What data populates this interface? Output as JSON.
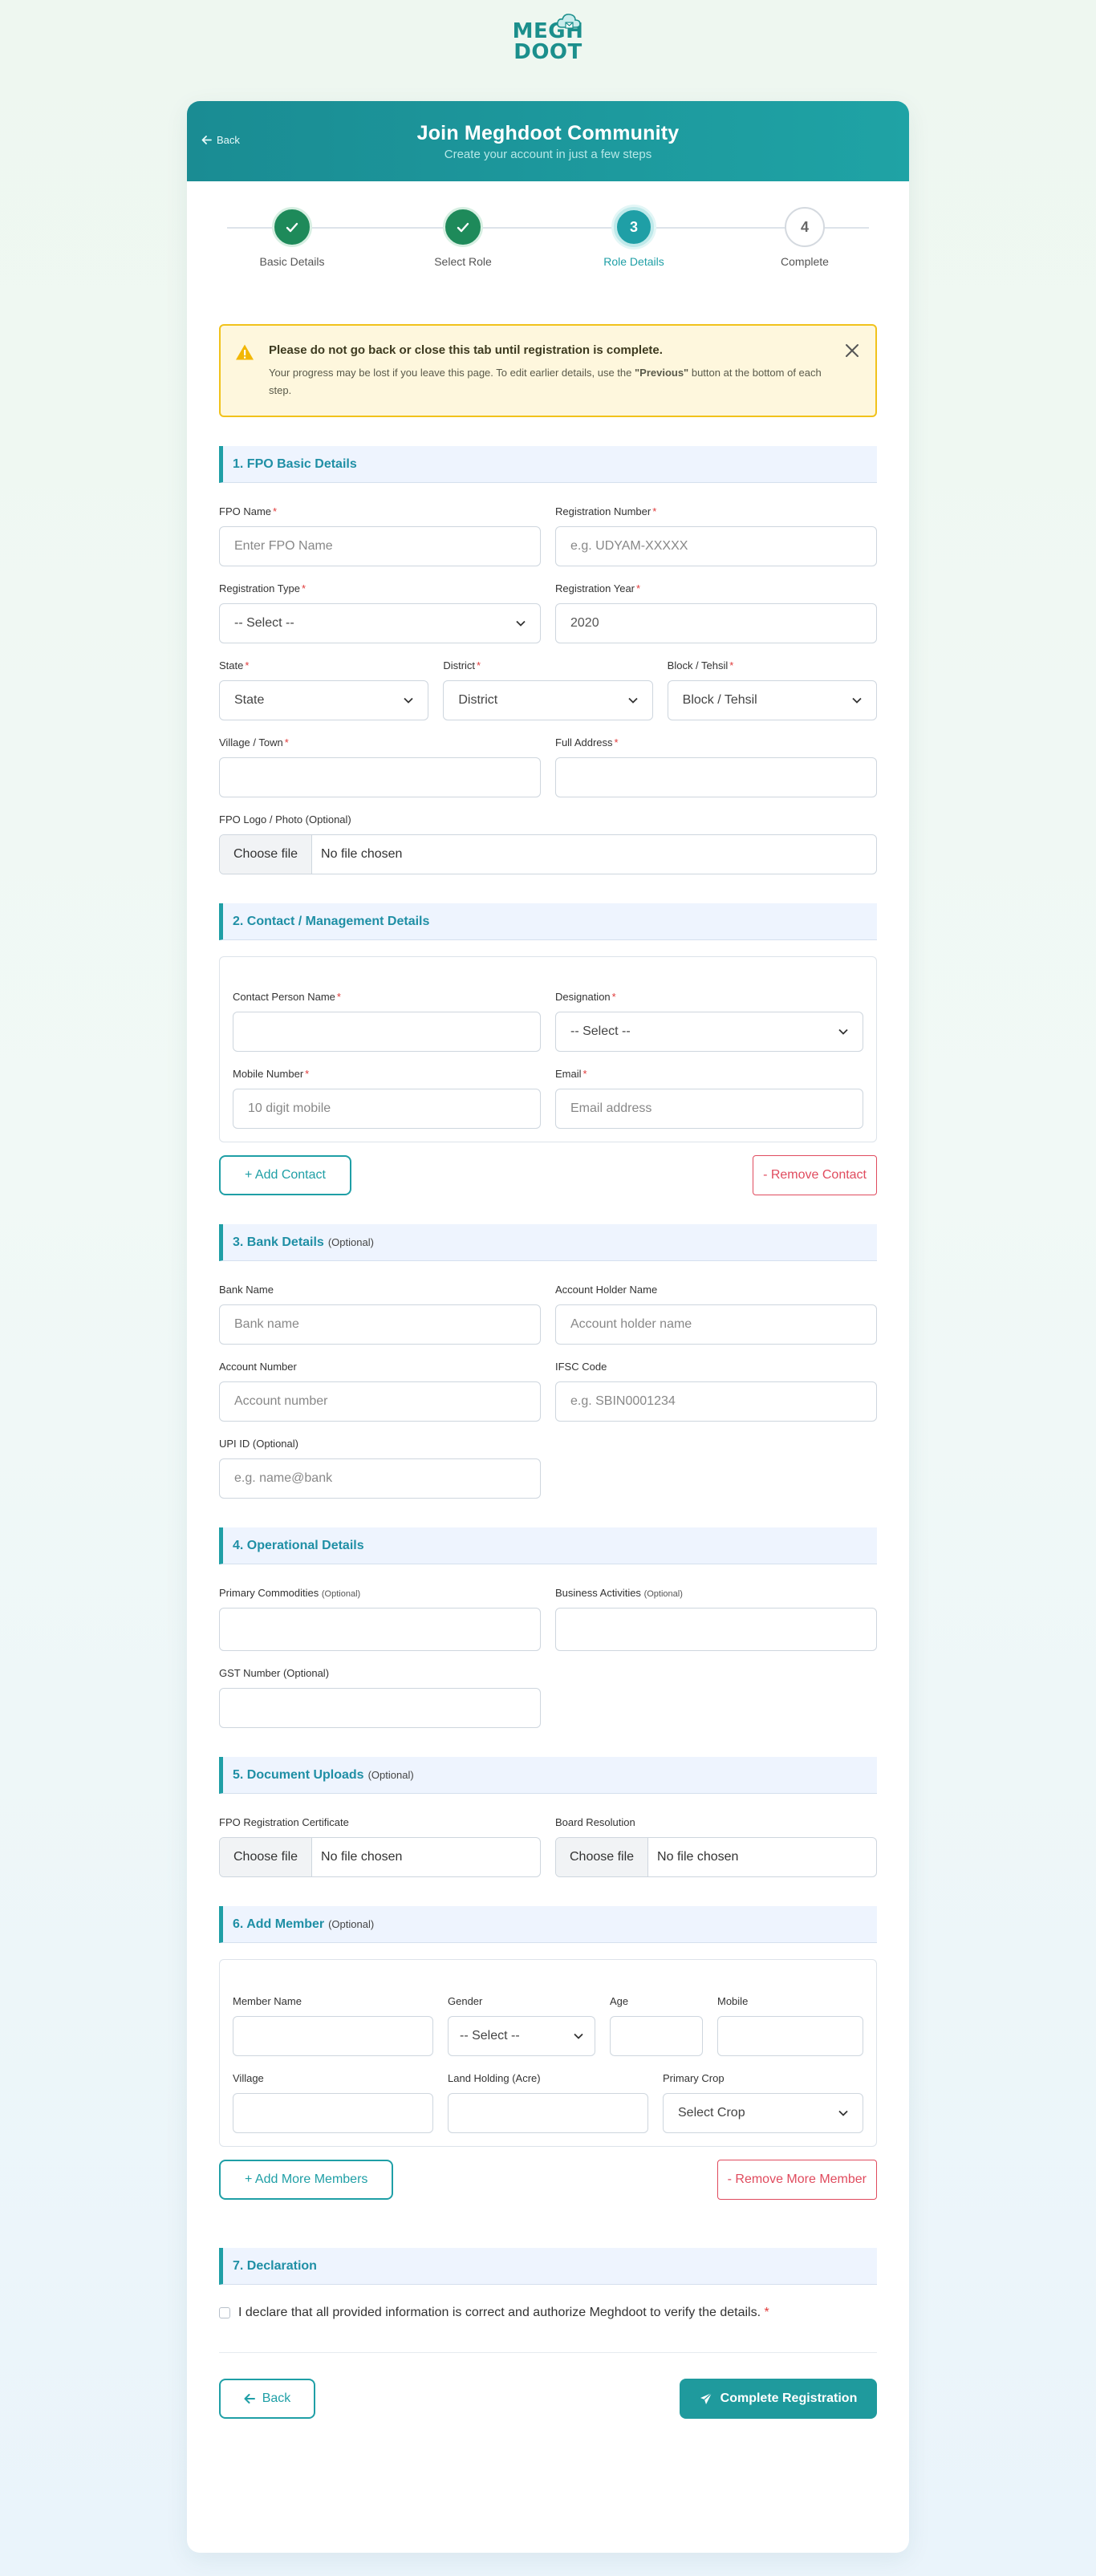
{
  "logo": {
    "line1": "MEGH",
    "line2": "DOOT"
  },
  "header": {
    "back_label": "Back",
    "title": "Join Meghdoot Community",
    "subtitle": "Create your account in just a few steps"
  },
  "steps": [
    {
      "number": "1",
      "label": "Basic Details",
      "state": "done"
    },
    {
      "number": "2",
      "label": "Select Role",
      "state": "done"
    },
    {
      "number": "3",
      "label": "Role Details",
      "state": "active"
    },
    {
      "number": "4",
      "label": "Complete",
      "state": "todo"
    }
  ],
  "warning": {
    "title": "Please do not go back or close this tab until registration is complete.",
    "text_before": "Your progress may be lost if you leave this page. To edit earlier details, use the ",
    "text_bold": "\"Previous\"",
    "text_after": " button at the bottom of each step."
  },
  "sections": {
    "basic": "1. FPO Basic Details",
    "contact": "2. Contact / Management Details",
    "bank": "3. Bank Details",
    "operational": "4. Operational Details",
    "documents": "5. Document Uploads",
    "member": "6. Add Member",
    "declaration": "7. Declaration",
    "optional": "(Optional)"
  },
  "basic": {
    "fpo_name_label": "FPO Name",
    "fpo_name_placeholder": "Enter FPO Name",
    "reg_number_label": "Registration Number",
    "reg_number_placeholder": "e.g. UDYAM-XXXXX",
    "reg_type_label": "Registration Type",
    "reg_type_value": "-- Select --",
    "reg_year_label": "Registration Year",
    "reg_year_value": "2020",
    "state_label": "State",
    "state_value": "State",
    "district_label": "District",
    "district_value": "District",
    "block_label": "Block / Tehsil",
    "block_value": "Block / Tehsil",
    "village_label": "Village / Town",
    "address_label": "Full Address",
    "logo_label": "FPO Logo / Photo (Optional)",
    "choose_file": "Choose file",
    "no_file": "No file chosen"
  },
  "contact": {
    "person_label": "Contact Person Name",
    "designation_label": "Designation",
    "designation_value": "-- Select --",
    "mobile_label": "Mobile Number",
    "mobile_placeholder": "10 digit mobile",
    "email_label": "Email",
    "email_placeholder": "Email address",
    "add_label": "+ Add Contact",
    "remove_label": "- Remove Contact"
  },
  "bank": {
    "bank_name_label": "Bank Name",
    "bank_name_placeholder": "Bank name",
    "holder_label": "Account Holder Name",
    "holder_placeholder": "Account holder name",
    "acc_number_label": "Account Number",
    "acc_number_placeholder": "Account number",
    "ifsc_label": "IFSC Code",
    "ifsc_placeholder": "e.g. SBIN0001234",
    "upi_label": "UPI ID (Optional)",
    "upi_placeholder": "e.g. name@bank"
  },
  "operational": {
    "commodities_label": "Primary Commodities",
    "activities_label": "Business Activities",
    "gst_label": "GST Number (Optional)",
    "optional_small": "(Optional)"
  },
  "documents": {
    "reg_cert_label": "FPO Registration Certificate",
    "board_label": "Board Resolution",
    "choose_file": "Choose file",
    "no_file": "No file chosen"
  },
  "member": {
    "name_label": "Member Name",
    "gender_label": "Gender",
    "gender_value": "-- Select --",
    "age_label": "Age",
    "mobile_label": "Mobile",
    "village_label": "Village",
    "land_label": "Land Holding (Acre)",
    "crop_label": "Primary Crop",
    "crop_value": "Select Crop",
    "add_label": "+ Add More Members",
    "remove_label": "- Remove More Member"
  },
  "declaration": {
    "text": "I declare that all provided information is correct and authorize Meghdoot to verify the details."
  },
  "footer": {
    "back_label": "Back",
    "submit_label": "Complete Registration"
  },
  "colors": {
    "accent": "#1f9fa6",
    "done": "#1e8a5a",
    "warning_border": "#f1c21b",
    "danger": "#e04b5e"
  }
}
